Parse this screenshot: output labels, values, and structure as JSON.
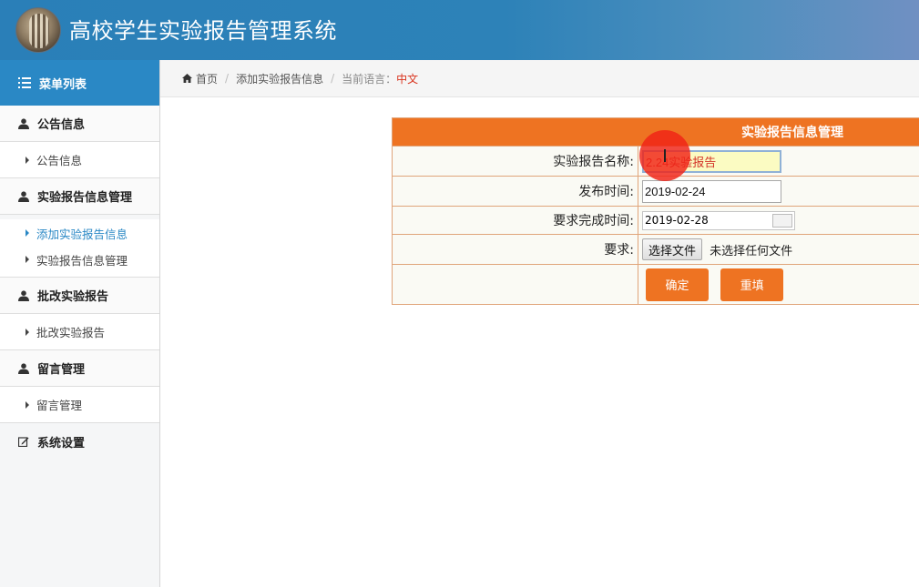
{
  "app": {
    "title": "高校学生实验报告管理系统"
  },
  "sidebar": {
    "heading": "菜单列表",
    "groups": [
      {
        "label": "公告信息",
        "items": [
          {
            "label": "公告信息"
          }
        ]
      },
      {
        "label": "实验报告信息管理",
        "items": [
          {
            "label": "添加实验报告信息"
          },
          {
            "label": "实验报告信息管理"
          }
        ]
      },
      {
        "label": "批改实验报告",
        "items": [
          {
            "label": "批改实验报告"
          }
        ]
      },
      {
        "label": "留言管理",
        "items": [
          {
            "label": "留言管理"
          }
        ]
      }
    ],
    "settings": "系统设置"
  },
  "breadcrumb": {
    "home": "首页",
    "current": "添加实验报告信息",
    "lang_label": "当前语言：",
    "lang_value": "中文"
  },
  "form": {
    "title": "实验报告信息管理",
    "fields": {
      "name": {
        "label": "实验报告名称:",
        "value": "2.24实验报告"
      },
      "publish": {
        "label": "发布时间:",
        "value": "2019-02-24"
      },
      "deadline": {
        "label": "要求完成时间:",
        "value": "2019-02-28"
      },
      "requirement": {
        "label": "要求:",
        "button": "选择文件",
        "status": "未选择任何文件"
      }
    },
    "buttons": {
      "submit": "确定",
      "reset": "重填"
    }
  },
  "colors": {
    "accent": "#EE7322",
    "brand": "#2A88C5",
    "header": "#2D82B8"
  }
}
